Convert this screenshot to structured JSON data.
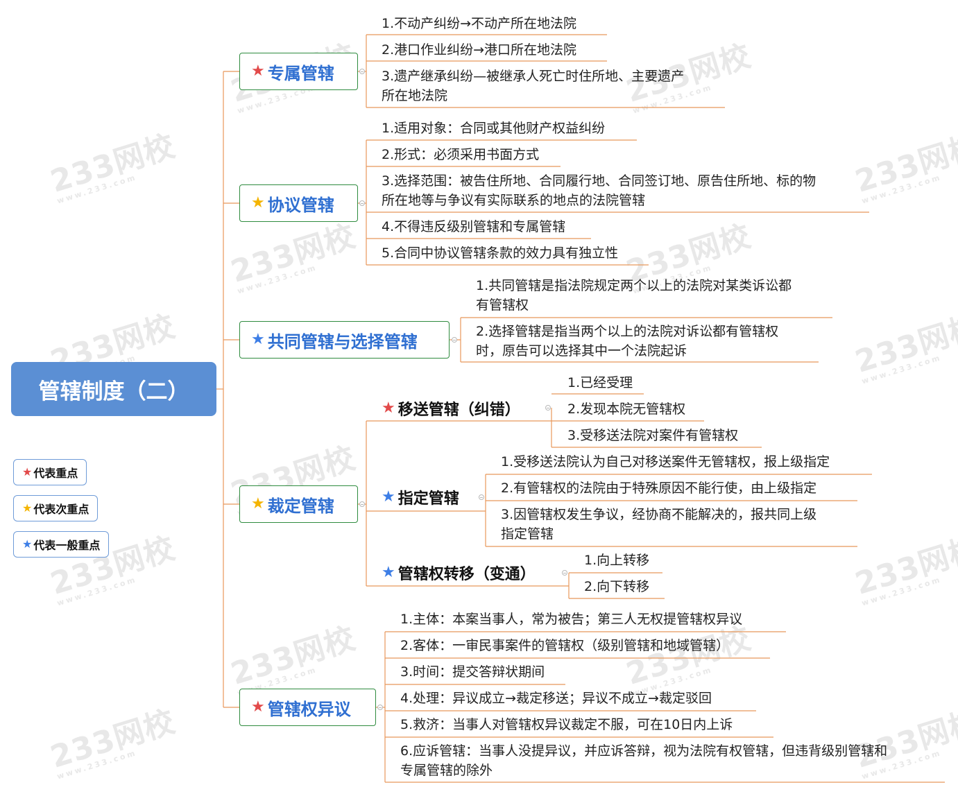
{
  "root": {
    "title": "管辖制度（二）"
  },
  "branches": {
    "b1": {
      "label": "专属管辖",
      "star": "red",
      "items": [
        "1.不动产纠纷→不动产所在地法院",
        "2.港口作业纠纷→港口所在地法院",
        "3.遗产继承纠纷—被继承人死亡时住所地、主要遗产",
        "所在地法院"
      ]
    },
    "b2": {
      "label": "协议管辖",
      "star": "yellow",
      "items": [
        "1.适用对象：合同或其他财产权益纠纷",
        "2.形式：必须采用书面方式",
        "3.选择范围：被告住所地、合同履行地、合同签订地、原告住所地、标的物",
        "所在地等与争议有实际联系的地点的法院管辖",
        "4.不得违反级别管辖和专属管辖",
        "5.合同中协议管辖条款的效力具有独立性"
      ]
    },
    "b3": {
      "label": "共同管辖与选择管辖",
      "star": "blue",
      "items": [
        "1.共同管辖是指法院规定两个以上的法院对某类诉讼都",
        "有管辖权",
        "2.选择管辖是指当两个以上的法院对诉讼都有管辖权",
        "时，原告可以选择其中一个法院起诉"
      ]
    },
    "b4": {
      "label": "裁定管辖",
      "star": "yellow",
      "subs": {
        "s1": {
          "label": "移送管辖（纠错）",
          "star": "red",
          "items": [
            "1.已经受理",
            "2.发现本院无管辖权",
            "3.受移送法院对案件有管辖权"
          ]
        },
        "s2": {
          "label": "指定管辖",
          "star": "blue",
          "items": [
            "1.受移送法院认为自己对移送案件无管辖权，报上级指定",
            "2.有管辖权的法院由于特殊原因不能行使，由上级指定",
            "3.因管辖权发生争议，经协商不能解决的，报共同上级",
            "指定管辖"
          ]
        },
        "s3": {
          "label": "管辖权转移（变通）",
          "star": "blue",
          "items": [
            "1.向上转移",
            "2.向下转移"
          ]
        }
      }
    },
    "b5": {
      "label": "管辖权异议",
      "star": "red",
      "items": [
        "1.主体：本案当事人，常为被告；第三人无权提管辖权异议",
        "2.客体：一审民事案件的管辖权（级别管辖和地域管辖）",
        "3.时间：提交答辩状期间",
        "4.处理：异议成立→裁定移送；异议不成立→裁定驳回",
        "5.救济：当事人对管辖权异议裁定不服，可在10日内上诉",
        "6.应诉管辖：当事人没提异议，并应诉答辩，视为法院有权管辖，但违背级别管辖和",
        "专属管辖的除外"
      ]
    }
  },
  "legend": [
    {
      "label": "代表重点",
      "star": "red"
    },
    {
      "label": "代表次重点",
      "star": "yellow"
    },
    {
      "label": "代表一般重点",
      "star": "blue"
    }
  ],
  "watermark": {
    "text": "233网校",
    "subtext": "www.233.com"
  },
  "colors": {
    "root": "#5b8fd4",
    "node_border": "#2e8b3e",
    "node_text": "#2f6fd1",
    "connector": "#e8975a",
    "star_red": "#e24a4a",
    "star_yellow": "#f4b400",
    "star_blue": "#3d7ee6"
  }
}
